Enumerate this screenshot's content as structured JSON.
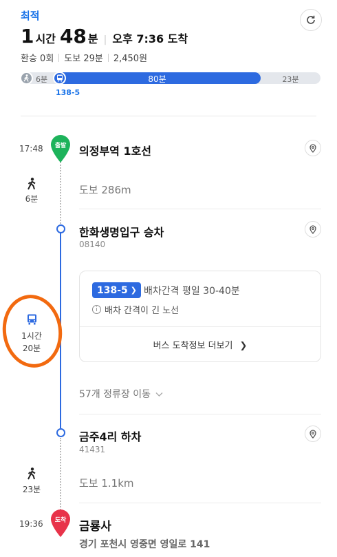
{
  "header": {
    "tag": "최적",
    "hours": "1",
    "hours_unit": "시간",
    "minutes": "48",
    "minutes_unit": "분",
    "arrival": "오후 7:36 도착",
    "transfers": "환승 0회",
    "walk": "도보 29분",
    "fare": "2,450원"
  },
  "progress": {
    "walk1": "6분",
    "bus": "80분",
    "walk2": "23분",
    "bus_number": "138-5"
  },
  "timeline": {
    "start": {
      "time": "17:48",
      "marker": "출발",
      "name": "의정부역 1호선"
    },
    "walk1": {
      "icon": "walk-icon",
      "duration": "6분",
      "text": "도보 286m"
    },
    "board": {
      "name": "한화생명입구 승차",
      "code": "08140"
    },
    "bus": {
      "number": "138-5",
      "interval": "배차간격 평일 30-40분",
      "note": "배차 간격이 긴 노선",
      "more": "버스 도착정보 더보기",
      "side_duration_1": "1시간",
      "side_duration_2": "20분",
      "stops": "57개 정류장 이동"
    },
    "alight": {
      "name": "금주4리 하차",
      "code": "41431"
    },
    "walk2": {
      "duration": "23분",
      "text": "도보 1.1km"
    },
    "end": {
      "time": "19:36",
      "marker": "도착",
      "name": "금룡사",
      "address": "경기 포천시 영중면 영일로 141"
    }
  },
  "colors": {
    "accent": "#1a73e8",
    "bus": "#2d6ae0",
    "start": "#1db35b",
    "end": "#e8334a",
    "annotation": "#f26a10"
  }
}
